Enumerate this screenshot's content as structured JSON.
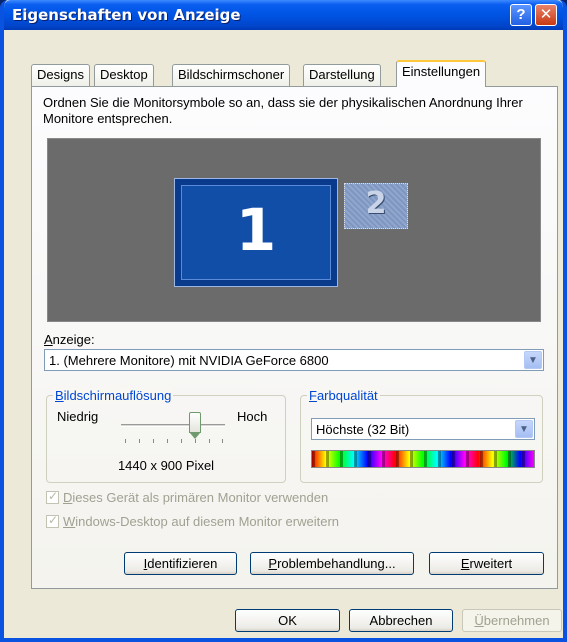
{
  "window": {
    "title": "Eigenschaften von Anzeige",
    "help_glyph": "?",
    "close_glyph": "✕"
  },
  "tabs": [
    {
      "label": "Designs"
    },
    {
      "label": "Desktop"
    },
    {
      "label": "Bildschirmschoner"
    },
    {
      "label": "Darstellung"
    },
    {
      "label": "Einstellungen"
    }
  ],
  "settings": {
    "description": "Ordnen Sie die Monitorsymbole so an, dass sie der physikalischen Anordnung Ihrer Monitore entsprechen.",
    "monitors": [
      "1",
      "2"
    ],
    "display_label_u": "A",
    "display_label_rest": "nzeige:",
    "display_value": "1. (Mehrere Monitore) mit NVIDIA GeForce 6800",
    "resolution": {
      "group_title_u": "B",
      "group_title_rest": "ildschirmauflösung",
      "low_label": "Niedrig",
      "high_label": "Hoch",
      "value_text": "1440 x 900 Pixel"
    },
    "color": {
      "group_title_u": "F",
      "group_title_rest": "arbqualität",
      "value": "Höchste (32 Bit)"
    },
    "primary_checkbox_u": "D",
    "primary_checkbox_rest": "ieses Gerät als primären Monitor verwenden",
    "extend_checkbox_u": "W",
    "extend_checkbox_rest": "indows-Desktop auf diesem Monitor erweitern",
    "identify_u": "I",
    "identify_rest": "dentifizieren",
    "troubleshoot_u": "P",
    "troubleshoot_rest": "roblembehandlung...",
    "advanced_u": "E",
    "advanced_rest": "rweitert"
  },
  "footer": {
    "ok": "OK",
    "cancel": "Abbrechen",
    "apply_u": "Ü",
    "apply_rest": "bernehmen"
  },
  "icons": {
    "dropdown_arrow": "chevron-down-icon",
    "help": "help-icon",
    "close": "close-icon"
  }
}
